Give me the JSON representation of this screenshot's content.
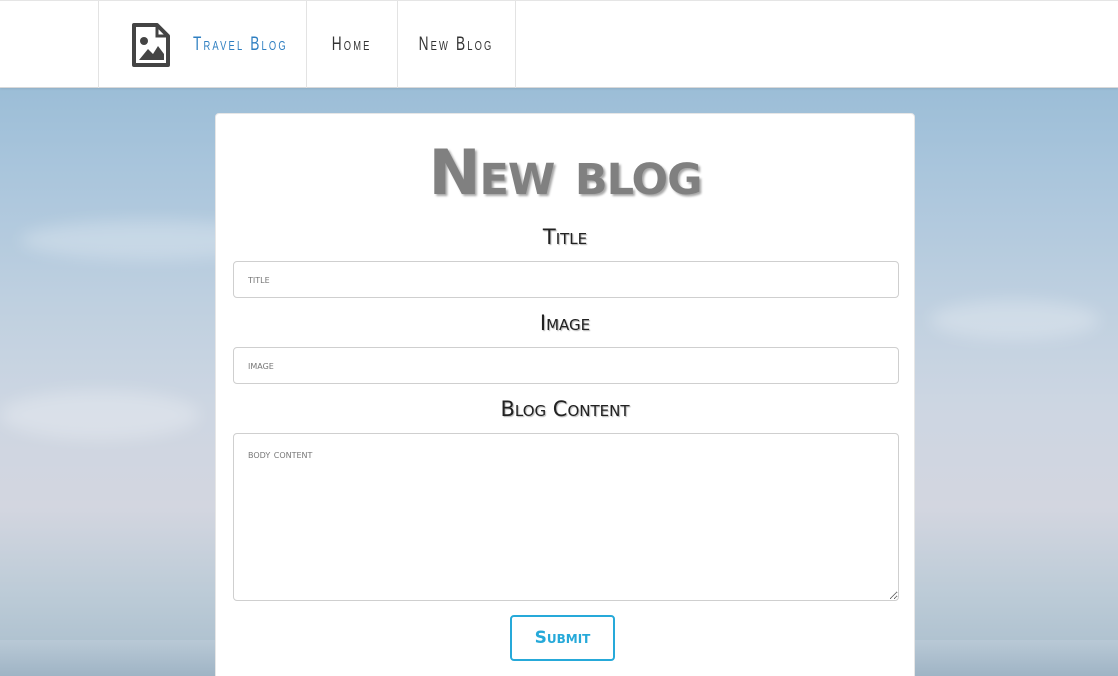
{
  "navbar": {
    "brand": "Travel Blog",
    "links": [
      "Home",
      "New Blog"
    ],
    "brand_icon": "image-file-icon",
    "brand_color": "#2f7fc1"
  },
  "form": {
    "heading": "New blog",
    "title_label": "Title",
    "title_placeholder": "title",
    "image_label": "Image",
    "image_placeholder": "image",
    "content_label": "Blog Content",
    "content_placeholder": "body content",
    "submit_label": "Submit",
    "accent_color": "#26a9d9"
  }
}
